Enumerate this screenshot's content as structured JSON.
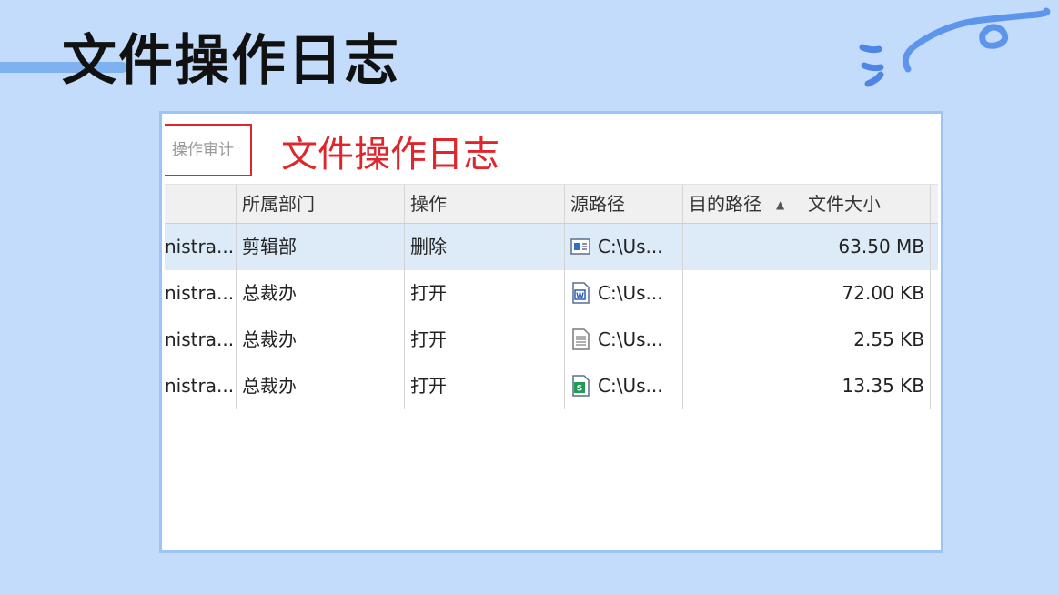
{
  "slide": {
    "title": "文件操作日志"
  },
  "screenshot": {
    "tab_label": "操作审计",
    "overlay_title": "文件操作日志",
    "columns": {
      "department": "所属部门",
      "operation": "操作",
      "source_path": "源路径",
      "dest_path": "目的路径",
      "file_size": "文件大小"
    },
    "rows": [
      {
        "user": "nistra...",
        "department": "剪辑部",
        "operation": "删除",
        "file_icon": "video-file-icon",
        "source_path": "C:\\Us...",
        "dest_path": "",
        "file_size": "63.50 MB"
      },
      {
        "user": "nistra...",
        "department": "总裁办",
        "operation": "打开",
        "file_icon": "word-file-icon",
        "source_path": "C:\\Us...",
        "dest_path": "",
        "file_size": "72.00 KB"
      },
      {
        "user": "nistra...",
        "department": "总裁办",
        "operation": "打开",
        "file_icon": "text-file-icon",
        "source_path": "C:\\Us...",
        "dest_path": "",
        "file_size": "2.55 KB"
      },
      {
        "user": "nistra...",
        "department": "总裁办",
        "operation": "打开",
        "file_icon": "spreadsheet-file-icon",
        "source_path": "C:\\Us...",
        "dest_path": "",
        "file_size": "13.35 KB"
      }
    ],
    "colors": {
      "accent_red": "#e0262d",
      "selected_row": "#ddebf8",
      "frame_border": "#9cc4f6"
    }
  }
}
